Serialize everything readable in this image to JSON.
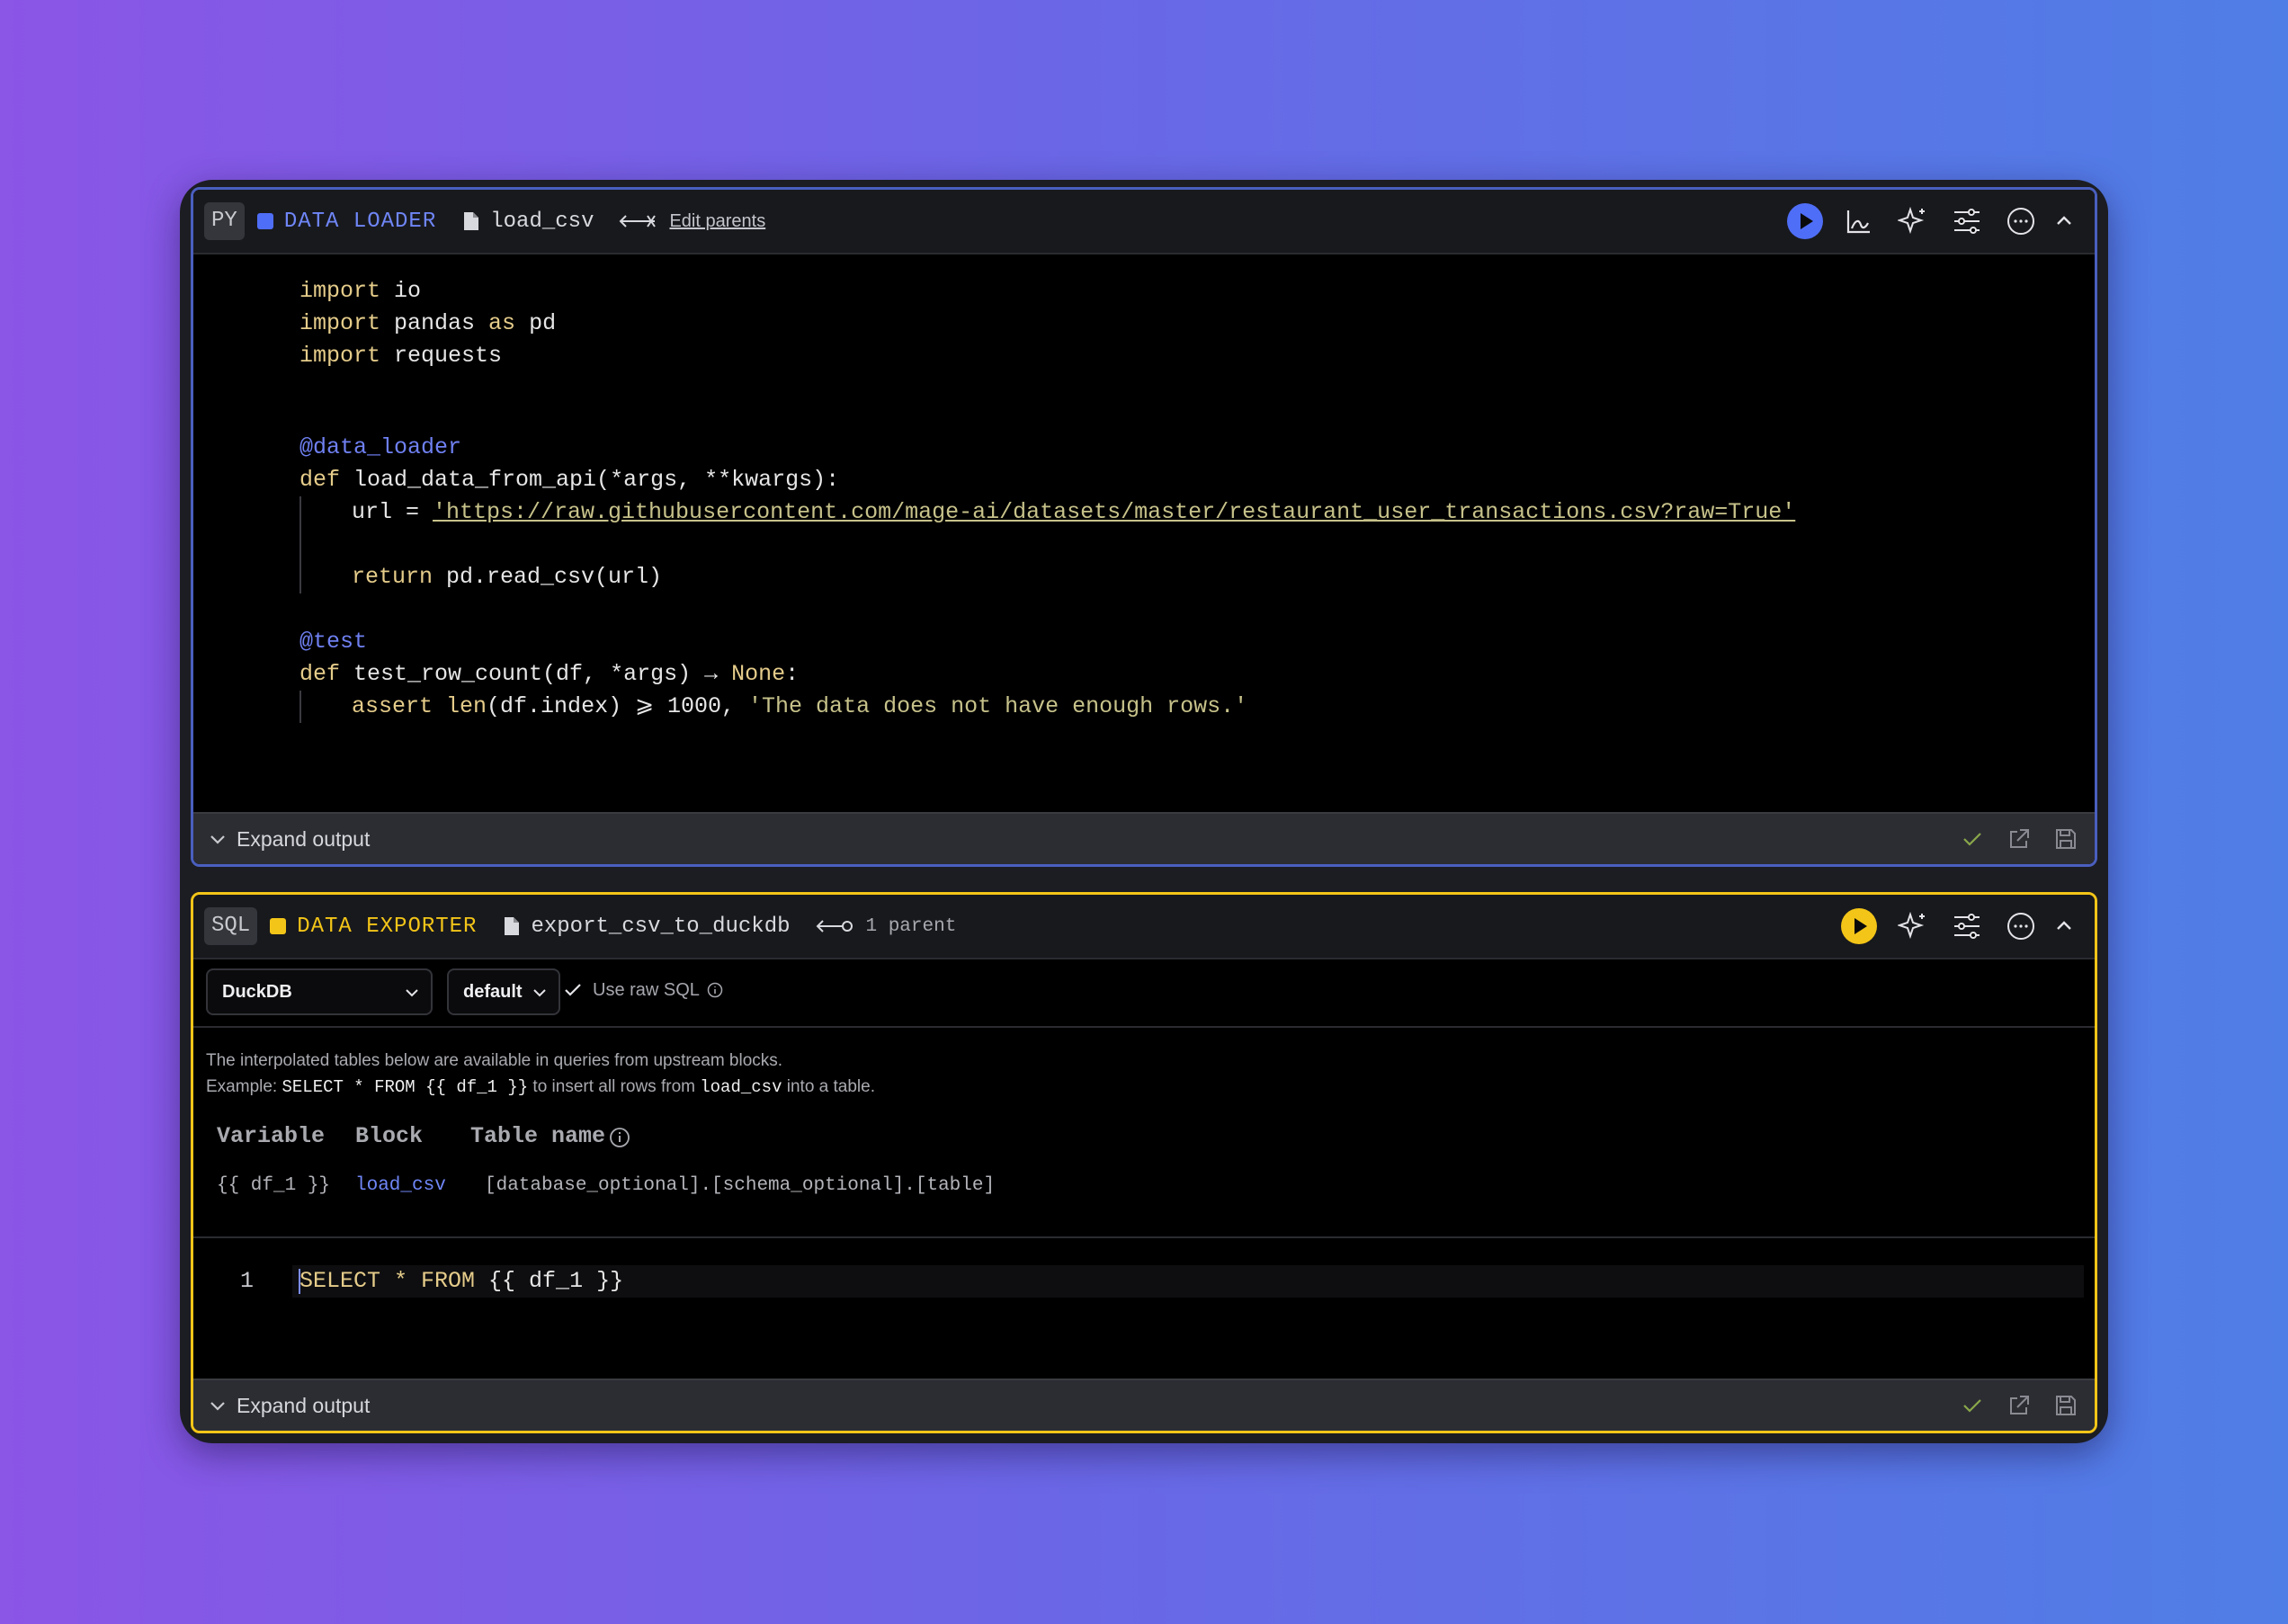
{
  "colors": {
    "loader_accent": "#4f6ef7",
    "exporter_accent": "#f3c518"
  },
  "loader": {
    "lang": "PY",
    "type": "DATA LOADER",
    "file": "load_csv",
    "parents_link": "Edit parents",
    "code": {
      "l1": "import",
      "l1b": " io",
      "l2": "import",
      "l2b": " pandas ",
      "l2c": "as",
      "l2d": " pd",
      "l3": "import",
      "l3b": " requests",
      "l4": "@data_loader",
      "l5": "def",
      "l5b": " load_data_from_api(*args, **kwargs):",
      "l6": "url = ",
      "l6b": "'https://raw.githubusercontent.com/mage-ai/datasets/master/restaurant_user_transactions.csv?raw=True'",
      "l7": "return",
      "l7b": " pd.read_csv(url)",
      "l8": "@test",
      "l9": "def",
      "l9b": " test_row_count(df, *args) → ",
      "l9c": "None",
      "l9d": ":",
      "l10": "assert ",
      "l10b": "len",
      "l10c": "(df.index) ⩾ 1000, ",
      "l10d": "'The data does not have enough rows.'"
    },
    "footer_label": "Expand output"
  },
  "exporter": {
    "lang": "SQL",
    "type": "DATA EXPORTER",
    "file": "export_csv_to_duckdb",
    "parents_count": "1 parent",
    "connection": "DuckDB",
    "profile": "default",
    "raw_sql_label": "Use raw SQL",
    "info_line1": "The interpolated tables below are available in queries from upstream blocks.",
    "info_example_prefix": "Example: ",
    "info_example_code": "SELECT * FROM {{ df_1 }}",
    "info_example_mid": " to insert all rows from ",
    "info_example_block": "load_csv",
    "info_example_suffix": " into a table.",
    "table_headers": {
      "variable": "Variable",
      "block": "Block",
      "table_name": "Table name"
    },
    "row": {
      "variable": "{{ df_1 }}",
      "block": "load_csv",
      "table_name": "[database_optional].[schema_optional].[table]"
    },
    "line_number": "1",
    "sql": {
      "a": "SELECT * FROM",
      "b": " {{ df_1 }}"
    },
    "footer_label": "Expand output"
  }
}
